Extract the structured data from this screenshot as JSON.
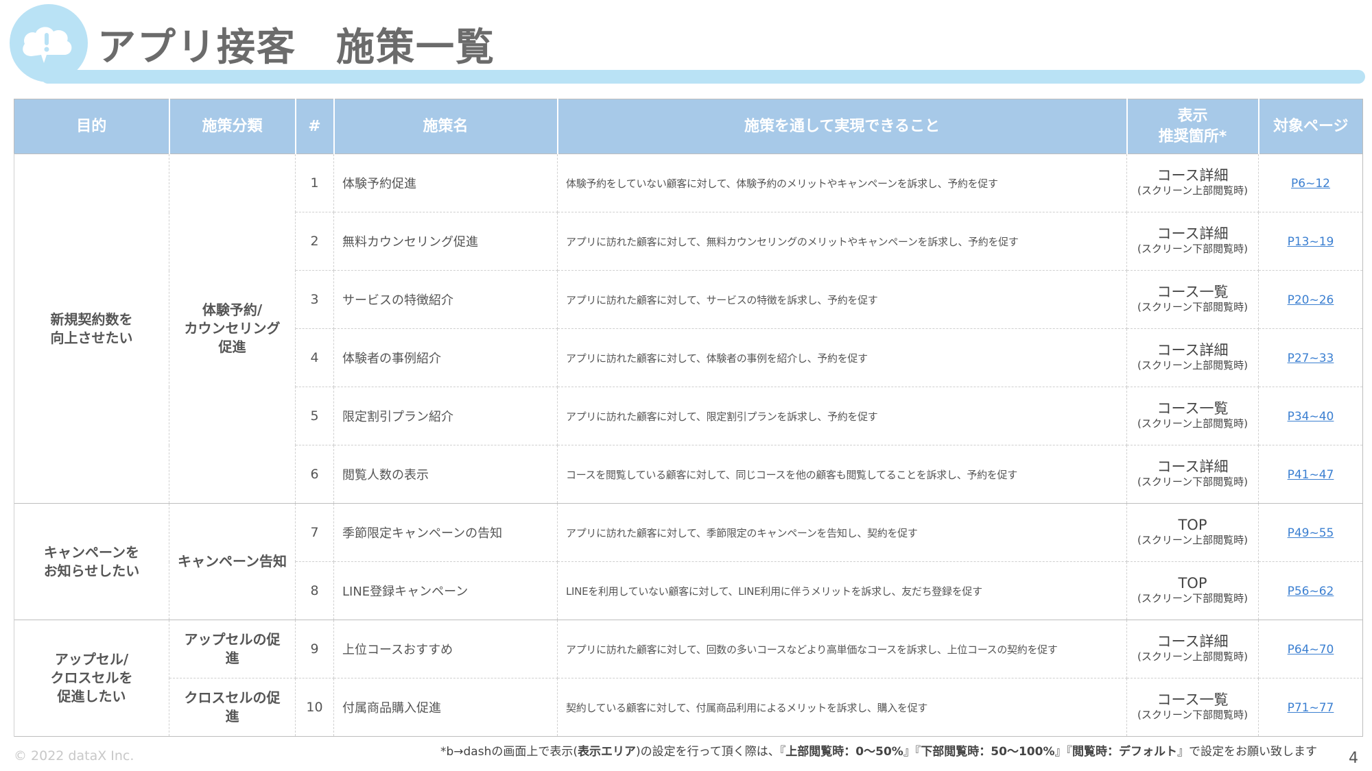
{
  "header": {
    "title": "アプリ接客　施策一覧"
  },
  "columns": [
    "目的",
    "施策分類",
    "#",
    "施策名",
    "施策を通して実現できること",
    "表示\n推奨箇所*",
    "対象ページ"
  ],
  "groups": [
    {
      "purpose": "新規契約数を\n向上させたい"
    },
    {
      "purpose": "キャンペーンを\nお知らせしたい"
    },
    {
      "purpose": "アップセル/\nクロスセルを\n促進したい"
    }
  ],
  "categories": [
    "体験予約/\nカウンセリング促進",
    "キャンペーン告知",
    "アップセルの促進",
    "クロスセルの促進"
  ],
  "rows": [
    {
      "num": "1",
      "name": "体験予約促進",
      "desc": "体験予約をしていない顧客に対して、体験予約のメリットやキャンペーンを訴求し、予約を促す",
      "place": "コース詳細",
      "place_sub": "(スクリーン上部閲覧時)",
      "page": "P6~12"
    },
    {
      "num": "2",
      "name": "無料カウンセリング促進",
      "desc": "アプリに訪れた顧客に対して、無料カウンセリングのメリットやキャンペーンを訴求し、予約を促す",
      "place": "コース詳細",
      "place_sub": "(スクリーン下部閲覧時)",
      "page": "P13~19"
    },
    {
      "num": "3",
      "name": "サービスの特徴紹介",
      "desc": "アプリに訪れた顧客に対して、サービスの特徴を訴求し、予約を促す",
      "place": "コース一覧",
      "place_sub": "(スクリーン下部閲覧時)",
      "page": "P20~26"
    },
    {
      "num": "4",
      "name": "体験者の事例紹介",
      "desc": "アプリに訪れた顧客に対して、体験者の事例を紹介し、予約を促す",
      "place": "コース詳細",
      "place_sub": "(スクリーン上部閲覧時)",
      "page": "P27~33"
    },
    {
      "num": "5",
      "name": "限定割引プラン紹介",
      "desc": "アプリに訪れた顧客に対して、限定割引プランを訴求し、予約を促す",
      "place": "コース一覧",
      "place_sub": "(スクリーン上部閲覧時)",
      "page": "P34~40"
    },
    {
      "num": "6",
      "name": "閲覧人数の表示",
      "desc": "コースを閲覧している顧客に対して、同じコースを他の顧客も閲覧してることを訴求し、予約を促す",
      "place": "コース詳細",
      "place_sub": "(スクリーン下部閲覧時)",
      "page": "P41~47"
    },
    {
      "num": "7",
      "name": "季節限定キャンペーンの告知",
      "desc": "アプリに訪れた顧客に対して、季節限定のキャンペーンを告知し、契約を促す",
      "place": "TOP",
      "place_sub": "(スクリーン上部閲覧時)",
      "page": "P49~55"
    },
    {
      "num": "8",
      "name": "LINE登録キャンペーン",
      "desc": "LINEを利用していない顧客に対して、LINE利用に伴うメリットを訴求し、友だち登録を促す",
      "place": "TOP",
      "place_sub": "(スクリーン下部閲覧時)",
      "page": "P56~62"
    },
    {
      "num": "9",
      "name": "上位コースおすすめ",
      "desc": "アプリに訪れた顧客に対して、回数の多いコースなどより高単価なコースを訴求し、上位コースの契約を促す",
      "place": "コース詳細",
      "place_sub": "(スクリーン上部閲覧時)",
      "page": "P64~70"
    },
    {
      "num": "10",
      "name": "付属商品購入促進",
      "desc": "契約している顧客に対して、付属商品利用によるメリットを訴求し、購入を促す",
      "place": "コース一覧",
      "place_sub": "(スクリーン下部閲覧時)",
      "page": "P71~77"
    }
  ],
  "footnote": {
    "prefix": "*b→dashの画面上で表示(",
    "bold1": "表示エリア",
    "mid1": ")の設定を行って頂く際は、『",
    "bold2": "上部閲覧時：0～50%",
    "mid2": "』『",
    "bold3": "下部閲覧時：50～100%",
    "mid3": "』『",
    "bold4": "閲覧時：デフォルト",
    "suffix": "』で設定をお願い致します"
  },
  "copyright": "© 2022 dataX Inc.",
  "page_number": "4",
  "colors": {
    "header_bg": "#a7c9e8",
    "accent_light": "#b9e2f5",
    "link": "#3b7fd1"
  }
}
